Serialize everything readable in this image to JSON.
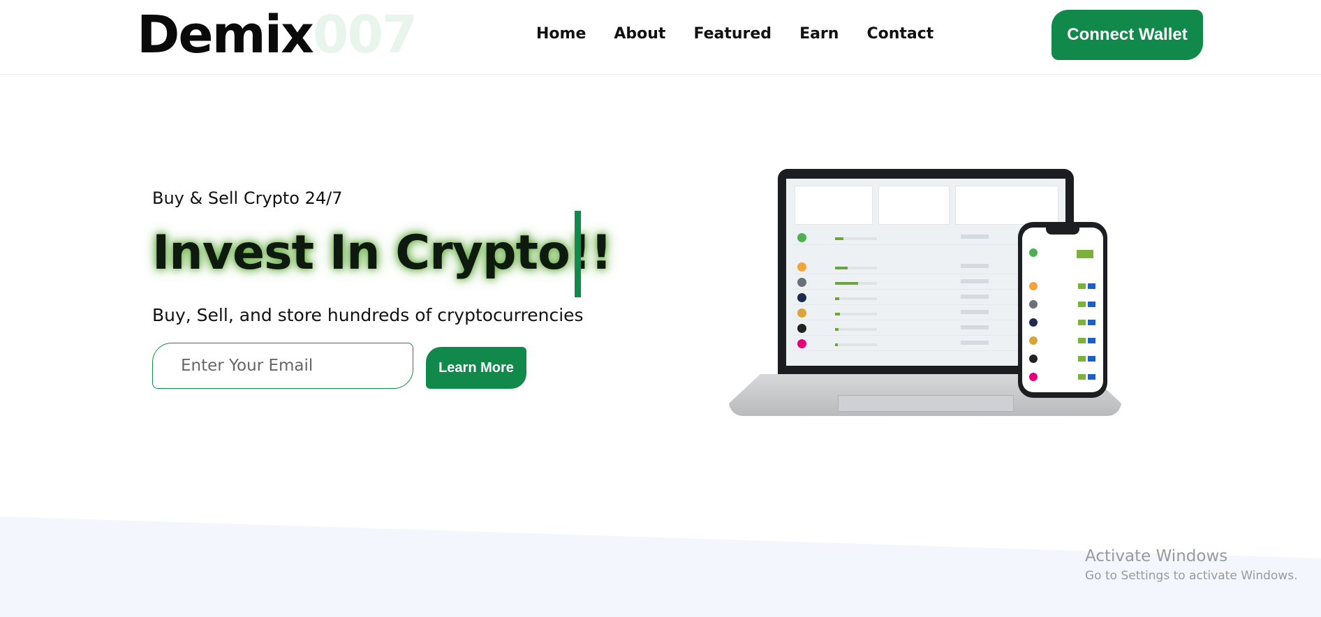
{
  "header": {
    "logo_main": "Demix",
    "logo_suffix": "007",
    "nav": [
      "Home",
      "About",
      "Featured",
      "Earn",
      "Contact"
    ],
    "cta_label": "Connect Wallet"
  },
  "hero": {
    "tagline": "Buy & Sell Crypto 24/7",
    "headline": "Invest In Crypto!!",
    "subline": "Buy, Sell, and store hundreds of cryptocurrencies",
    "email_placeholder": "Enter Your Email",
    "button_label": "Learn More"
  },
  "watermark": {
    "title": "Activate Windows",
    "subtitle": "Go to Settings to activate Windows."
  },
  "colors": {
    "brand_green": "#11894a",
    "glow_green": "#5eaa38",
    "logo_suffix": "#e8f5ec",
    "band": "#f3f6fc"
  },
  "illustration": {
    "name": "laptop-and-phone-crypto-dashboard",
    "coin_colors": [
      "#f2a33a",
      "#6b6f7a",
      "#1d2b4f",
      "#d9a53a",
      "#222222",
      "#e6007a"
    ]
  }
}
